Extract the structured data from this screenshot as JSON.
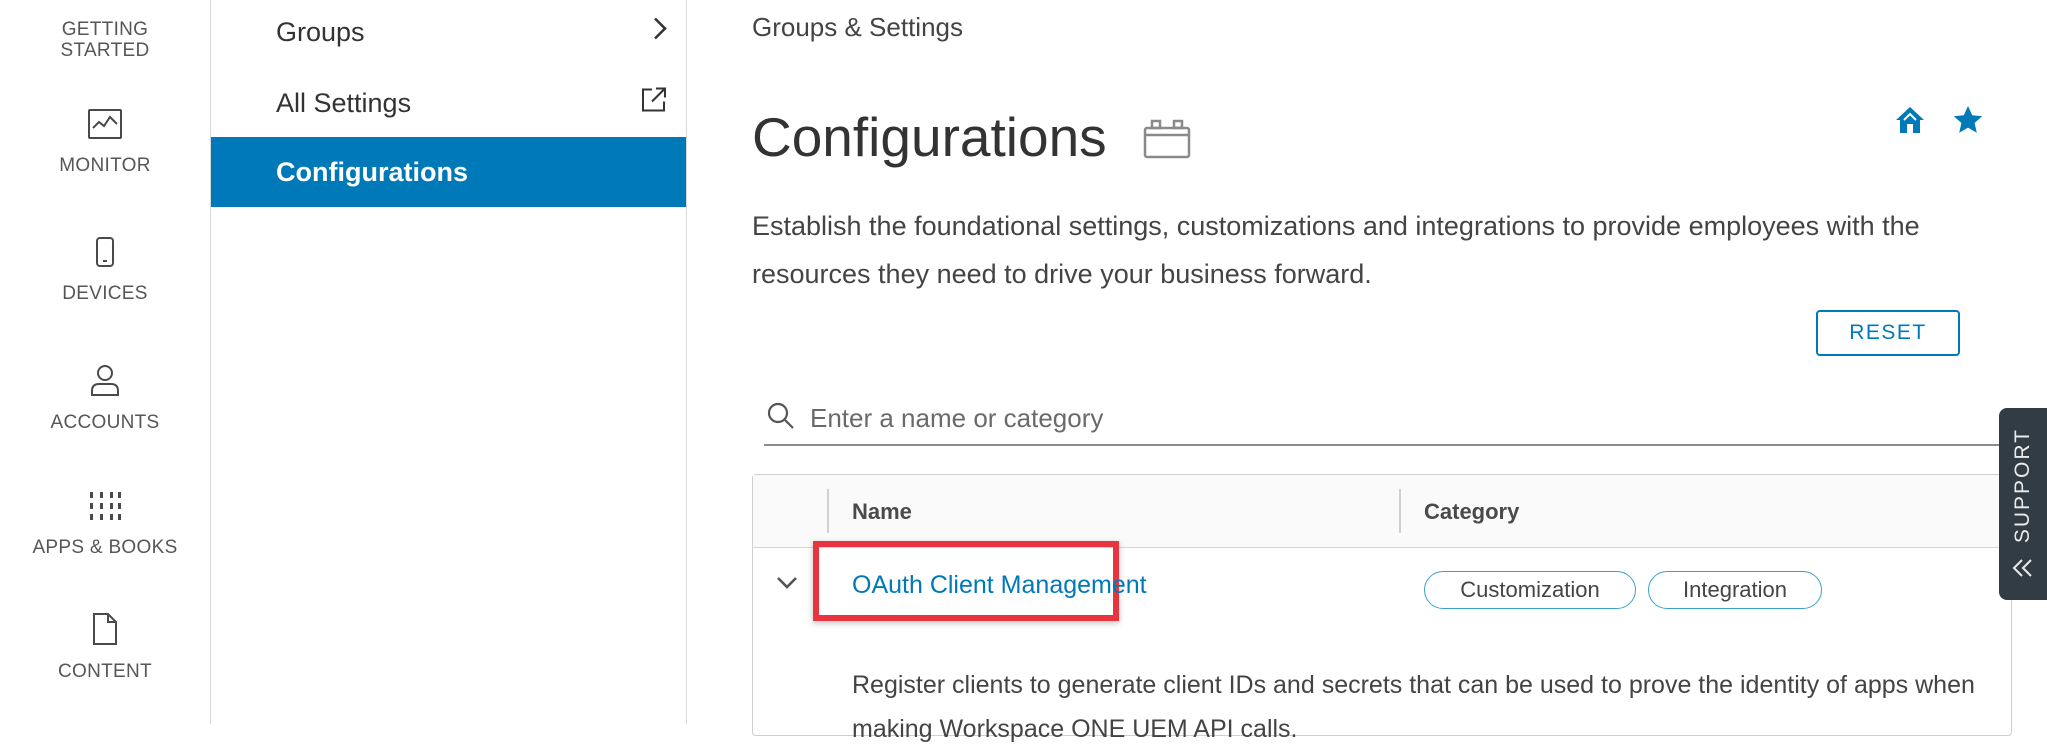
{
  "rail": {
    "items": [
      {
        "label": "GETTING\nSTARTED",
        "icon": "getting-started-icon"
      },
      {
        "label": "MONITOR",
        "icon": "monitor-icon"
      },
      {
        "label": "DEVICES",
        "icon": "device-icon"
      },
      {
        "label": "ACCOUNTS",
        "icon": "user-icon"
      },
      {
        "label": "APPS & BOOKS",
        "icon": "apps-grid-icon"
      },
      {
        "label": "CONTENT",
        "icon": "document-icon"
      }
    ]
  },
  "subnav": {
    "items": [
      {
        "label": "Groups",
        "icon": "chevron-right-icon"
      },
      {
        "label": "All Settings",
        "icon": "external-link-icon"
      },
      {
        "label": "Configurations",
        "active": true
      }
    ]
  },
  "breadcrumb": "Groups & Settings",
  "page": {
    "title": "Configurations",
    "description": "Establish the foundational settings, customizations and integrations to provide employees with the resources they need to drive your business forward.",
    "reset_label": "RESET"
  },
  "search": {
    "placeholder": "Enter a name or category"
  },
  "table": {
    "headers": {
      "name": "Name",
      "category": "Category"
    },
    "rows": [
      {
        "name": "OAuth Client Management",
        "tags": [
          "Customization",
          "Integration"
        ],
        "description": "Register clients to generate client IDs and secrets that can be used to prove the identity of apps when making Workspace ONE UEM API calls."
      }
    ]
  },
  "support": {
    "label": "SUPPORT"
  },
  "colors": {
    "accent": "#0079b8",
    "highlight": "#e8343e",
    "support_bg": "#313c45"
  }
}
